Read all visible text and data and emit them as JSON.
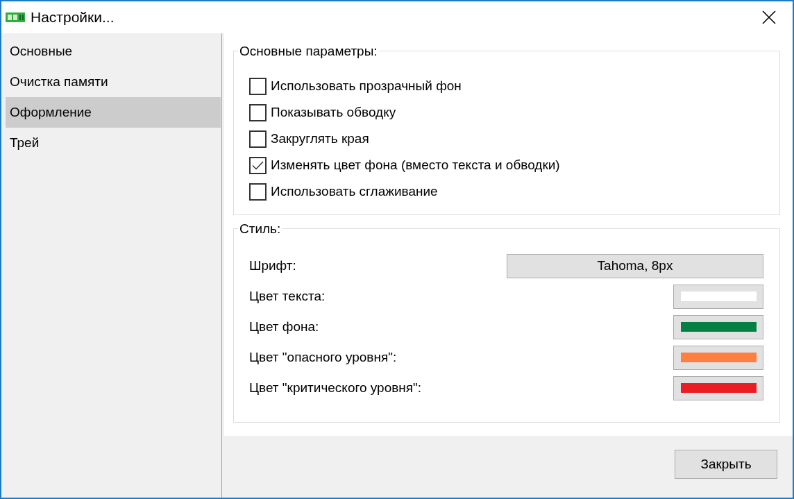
{
  "window": {
    "title": "Настройки..."
  },
  "sidebar": {
    "items": [
      {
        "label": "Основные",
        "selected": false
      },
      {
        "label": "Очистка памяти",
        "selected": false
      },
      {
        "label": "Оформление",
        "selected": true
      },
      {
        "label": "Трей",
        "selected": false
      }
    ]
  },
  "general_group": {
    "title": "Основные параметры:",
    "options": [
      {
        "label": "Использовать прозрачный фон",
        "checked": false
      },
      {
        "label": "Показывать обводку",
        "checked": false
      },
      {
        "label": "Закруглять края",
        "checked": false
      },
      {
        "label": "Изменять цвет фона (вместо текста и обводки)",
        "checked": true
      },
      {
        "label": "Использовать сглаживание",
        "checked": false
      }
    ]
  },
  "style_group": {
    "title": "Стиль:",
    "rows": [
      {
        "kind": "font",
        "label": "Шрифт:",
        "value": "Tahoma, 8px"
      },
      {
        "kind": "color",
        "label": "Цвет текста:",
        "color": "#ffffff"
      },
      {
        "kind": "color",
        "label": "Цвет фона:",
        "color": "#067f43"
      },
      {
        "kind": "color",
        "label": "Цвет \"опасного уровня\":",
        "color": "#fe7f3f"
      },
      {
        "kind": "color",
        "label": "Цвет \"критического уровня\":",
        "color": "#ea1d25"
      }
    ]
  },
  "buttons": [
    "Закрыть"
  ]
}
